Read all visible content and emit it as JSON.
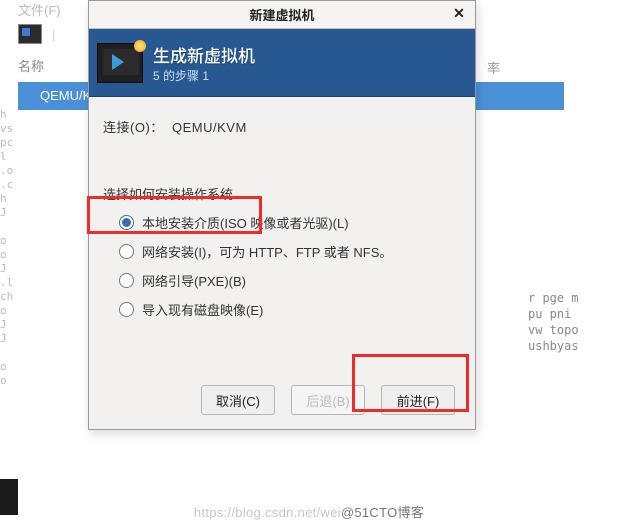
{
  "background": {
    "top_menu": "文件(F)",
    "column_name_header": "名称",
    "column_rate_header": "率",
    "qemu_row": "QEMU/KV",
    "left_strip": "h\nvs\npc\nl\n.o\n.c\nh\nJ\n   \no\no\nJ\n.l\nch\no\nJ\nJ\n \no\no",
    "right_text": "r pge m\npu pni\nvw topo\nushbyas"
  },
  "dialog": {
    "title": "新建虚拟机",
    "banner_title": "生成新虚拟机",
    "banner_sub": "5 的步骤 1",
    "connection_key": "连接(O)：",
    "connection_value": "QEMU/KVM",
    "section_label": "选择如何安装操作系统",
    "options": [
      "本地安装介质(ISO 映像或者光驱)(L)",
      "网络安装(I)，可为 HTTP、FTP 或者 NFS。",
      "网络引导(PXE)(B)",
      "导入现有磁盘映像(E)"
    ],
    "buttons": {
      "cancel": "取消(C)",
      "back": "后退(B)",
      "forward": "前进(F)"
    }
  },
  "watermark": {
    "part1": "https://blog.csdn.net/wei",
    "part2": "@51CTO博客"
  }
}
